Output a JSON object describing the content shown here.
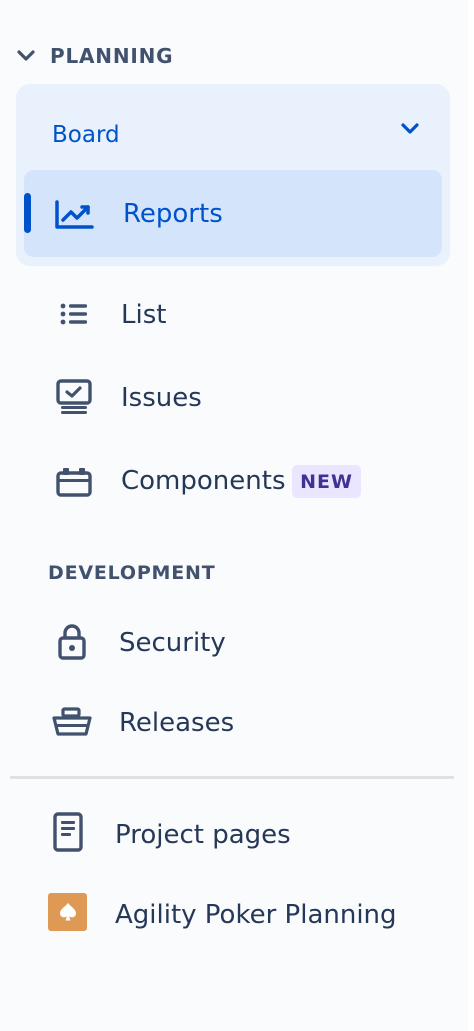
{
  "sidebar": {
    "planning": {
      "title": "PLANNING",
      "icon": "chevron-down-icon"
    },
    "board": {
      "label": "Board",
      "icon": "chevron-down-icon"
    },
    "items": [
      {
        "label": "Reports",
        "icon": "chart-icon",
        "active": true
      },
      {
        "label": "List",
        "icon": "list-icon"
      },
      {
        "label": "Issues",
        "icon": "issues-icon"
      },
      {
        "label": "Components",
        "icon": "components-icon",
        "badge": "NEW"
      }
    ],
    "development": {
      "title": "DEVELOPMENT",
      "items": [
        {
          "label": "Security",
          "icon": "lock-icon"
        },
        {
          "label": "Releases",
          "icon": "ship-icon"
        }
      ]
    },
    "footer_items": [
      {
        "label": "Project pages",
        "icon": "page-icon"
      },
      {
        "label": "Agility Poker Planning",
        "icon": "spade-card-icon"
      }
    ]
  },
  "colors": {
    "accent": "#0052cc",
    "selected_bg": "#d4e4fb",
    "group_bg": "#e9f1fd",
    "text": "#253858",
    "badge_bg": "#eae6ff",
    "badge_text": "#403294",
    "app_icon": "#de9a55"
  }
}
